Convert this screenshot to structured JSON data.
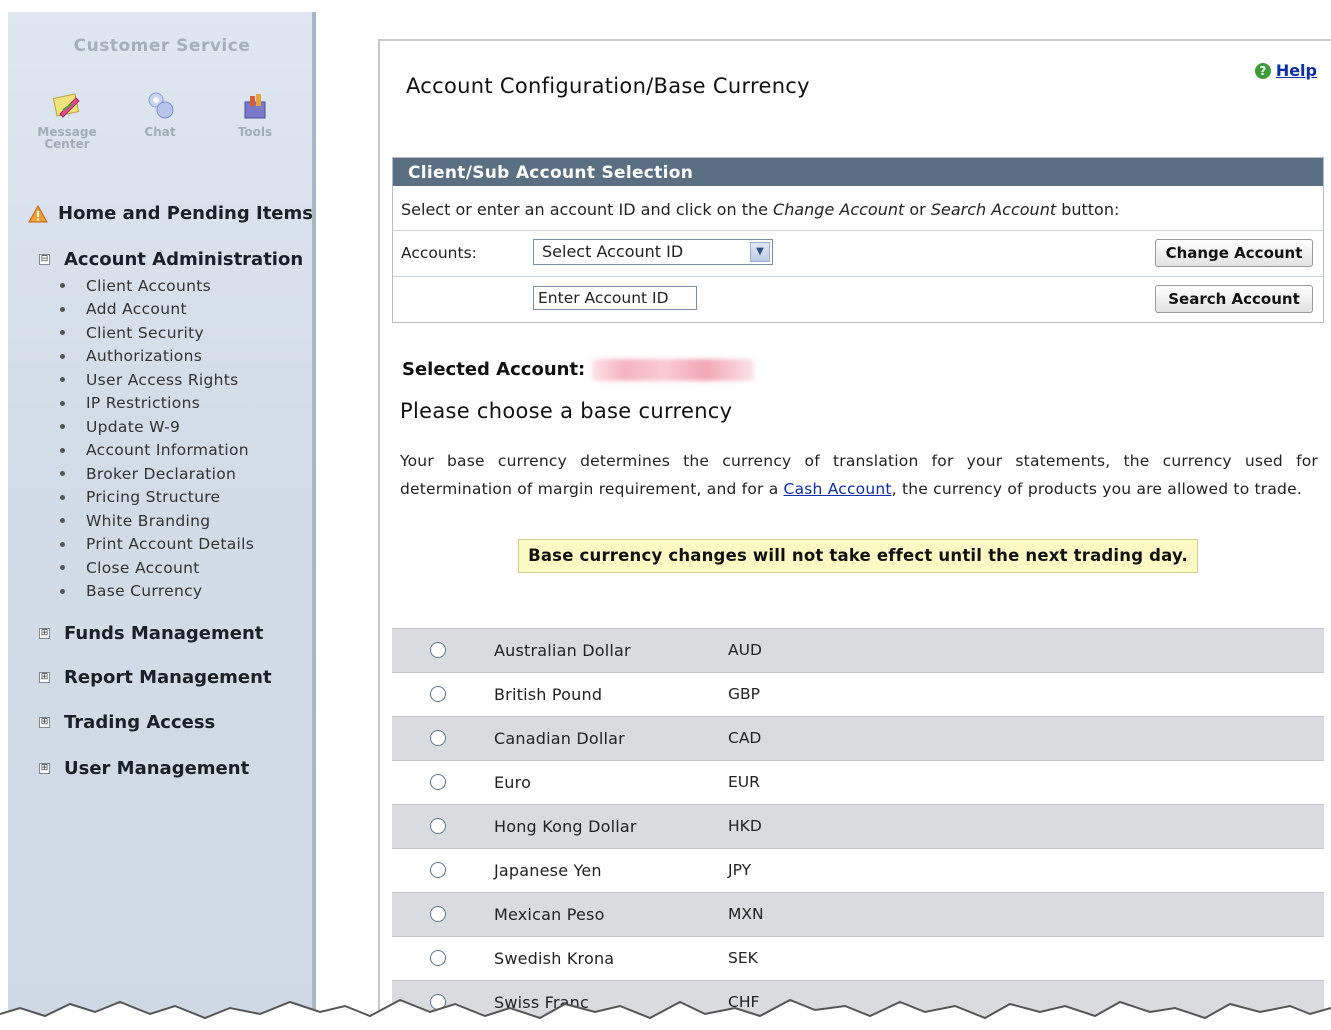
{
  "sidebar": {
    "title": "Customer Service",
    "tools": [
      {
        "label": "Message Center",
        "icon": "message-center-icon"
      },
      {
        "label": "Chat",
        "icon": "chat-icon"
      },
      {
        "label": "Tools",
        "icon": "tools-icon"
      }
    ],
    "sections": {
      "home": "Home and Pending Items",
      "account_admin": "Account Administration",
      "funds": "Funds Management",
      "report": "Report Management",
      "trading": "Trading Access",
      "user": "User Management"
    },
    "account_admin_items": [
      "Client Accounts",
      "Add Account",
      "Client Security",
      "Authorizations",
      "User Access Rights",
      "IP Restrictions",
      "Update W-9",
      "Account Information",
      "Broker Declaration",
      "Pricing Structure",
      "White Branding",
      "Print Account Details",
      "Close Account",
      "Base Currency"
    ],
    "toggle_expanded": "⊟",
    "toggle_collapsed": "⊞"
  },
  "main": {
    "title": "Account Configuration/Base Currency",
    "help_label": "Help",
    "selection": {
      "header": "Client/Sub Account Selection",
      "instruction_prefix": "Select or enter an account ID and click on the ",
      "instruction_change": "Change Account",
      "instruction_or": " or ",
      "instruction_search": "Search Account",
      "instruction_suffix": " button:",
      "accounts_label": "Accounts:",
      "select_value": "Select Account ID",
      "input_value": "Enter Account ID",
      "change_button": "Change Account",
      "search_button": "Search Account"
    },
    "selected_account_label": "Selected Account:",
    "choose_title": "Please choose a base currency",
    "description_part1": "Your base currency determines the currency of translation for your statements, the currency used for determination of margin requirement, and for a ",
    "description_link": "Cash Account",
    "description_part2": ", the currency of products you are allowed to trade.",
    "notice": "Base currency changes will not take effect until the next trading day.",
    "currencies": [
      {
        "name": "Australian Dollar",
        "code": "AUD"
      },
      {
        "name": "British Pound",
        "code": "GBP"
      },
      {
        "name": "Canadian Dollar",
        "code": "CAD"
      },
      {
        "name": "Euro",
        "code": "EUR"
      },
      {
        "name": "Hong Kong Dollar",
        "code": "HKD"
      },
      {
        "name": "Japanese Yen",
        "code": "JPY"
      },
      {
        "name": "Mexican Peso",
        "code": "MXN"
      },
      {
        "name": "Swedish Krona",
        "code": "SEK"
      },
      {
        "name": "Swiss Franc",
        "code": "CHF"
      }
    ]
  },
  "colors": {
    "section_header": "#5b6f82",
    "link": "#0d2ea8",
    "notice_bg": "#fcf9c5",
    "row_alt": "#dadbdf",
    "sidebar_bg": "#d3dde8"
  }
}
